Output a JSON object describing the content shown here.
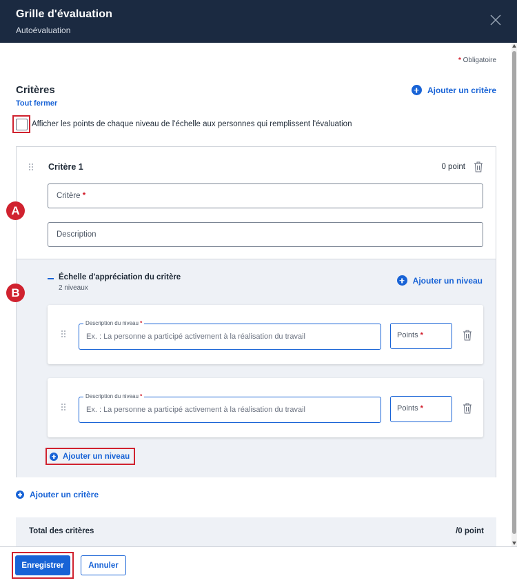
{
  "header": {
    "title": "Grille d'évaluation",
    "subtitle": "Autoévaluation"
  },
  "form": {
    "required_star": "*",
    "required_note": "Obligatoire"
  },
  "criteria_section": {
    "title": "Critères",
    "collapse_all": "Tout fermer",
    "add_criterion": "Ajouter un critère",
    "show_points_label": "Afficher les points de chaque niveau de l'échelle aux personnes qui remplissent l'évaluation"
  },
  "criterion": {
    "title": "Critère 1",
    "points": "0 point",
    "name_placeholder": "Critère",
    "description_placeholder": "Description",
    "scale": {
      "title": "Échelle d'appréciation du critère",
      "count": "2 niveaux",
      "add_level": "Ajouter un niveau",
      "levels": [
        {
          "desc_label": "Description du niveau",
          "desc_placeholder": "Ex. : La personne a participé activement à la réalisation du travail",
          "points_label": "Points"
        },
        {
          "desc_label": "Description du niveau",
          "desc_placeholder": "Ex. : La personne a participé activement à la réalisation du travail",
          "points_label": "Points"
        }
      ]
    }
  },
  "markers": {
    "a": "A",
    "b": "B"
  },
  "total": {
    "label": "Total des critères",
    "value": "/0 point"
  },
  "footer": {
    "save": "Enregistrer",
    "cancel": "Annuler"
  },
  "colors": {
    "header_bg": "#1b2a41",
    "accent": "#1863d6",
    "highlight": "#d0222f",
    "panel_bg": "#eef1f6"
  }
}
